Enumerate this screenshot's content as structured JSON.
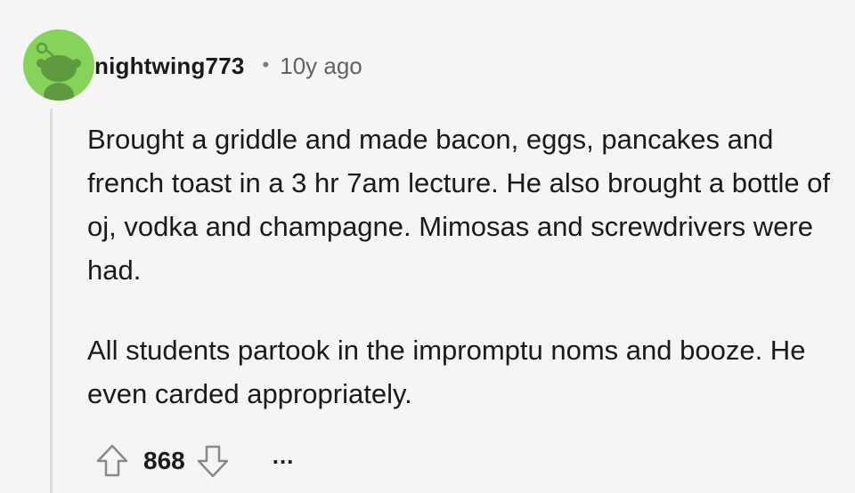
{
  "comment": {
    "author": "nightwing773",
    "separator": "•",
    "age": "10y ago",
    "paragraphs": [
      "Brought a griddle and made bacon, eggs, pancakes and french toast in a 3 hr 7am lecture. He also brought a bottle of oj, vodka and champagne. Mimosas and screwdrivers were had.",
      "All students partook in the impromptu noms and booze. He even carded appropriately."
    ],
    "score": "868",
    "more_label": "..."
  },
  "colors": {
    "avatar_bg": "#86d35a",
    "background": "#f5f5f5",
    "text": "#1a1a1b",
    "muted": "#5f6368"
  },
  "icons": {
    "avatar": "reddit-snoo-avatar",
    "upvote": "arrow-up-outline-icon",
    "downvote": "arrow-down-outline-icon",
    "more": "ellipsis-icon"
  }
}
